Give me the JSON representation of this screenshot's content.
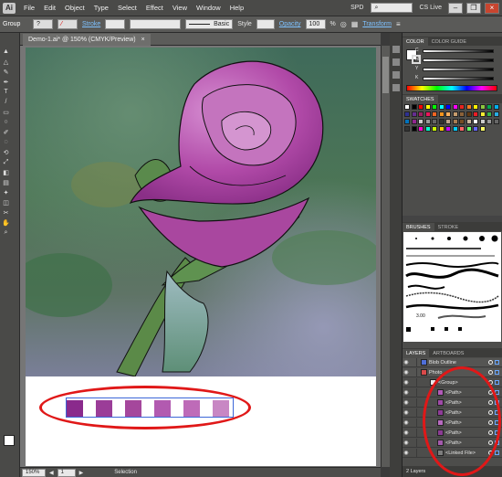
{
  "app_logo": "Ai",
  "menu": [
    "File",
    "Edit",
    "Object",
    "Type",
    "Select",
    "Effect",
    "View",
    "Window",
    "Help"
  ],
  "workspace": "SPD",
  "cs_live": "CS Live",
  "control": {
    "selection": "Group",
    "stroke_label": "Stroke",
    "brush_label": "Basic",
    "style_label": "Style",
    "opacity_label": "Opacity",
    "opacity_value": "100",
    "opacity_unit": "%",
    "transform_label": "Transform"
  },
  "document_tab": {
    "title": "Demo-1.ai* @ 150% (CMYK/Preview)",
    "close": "×"
  },
  "status": {
    "zoom": "150%",
    "artboard": "1",
    "tool": "Selection"
  },
  "color_panel": {
    "tabs": [
      "COLOR",
      "COLOR GUIDE"
    ],
    "sliders": [
      "C",
      "M",
      "Y",
      "K"
    ]
  },
  "swatches_panel": {
    "tabs": [
      "SWATCHES"
    ]
  },
  "brushes_panel": {
    "tabs": [
      "BRUSHES",
      "STROKE"
    ],
    "brush_size": "3.00"
  },
  "layers_panel": {
    "tabs": [
      "LAYERS",
      "ARTBOARDS"
    ],
    "rows": [
      {
        "name": "Blob Outline",
        "color": "#4f6fd8"
      },
      {
        "name": "Photo",
        "color": "#d94a4a"
      },
      {
        "name": "<Group>",
        "color": "#e8e8e8"
      },
      {
        "name": "<Path>",
        "color": "#b25ab8"
      },
      {
        "name": "<Path>",
        "color": "#a04aa8"
      },
      {
        "name": "<Path>",
        "color": "#8f3c98"
      },
      {
        "name": "<Path>",
        "color": "#b86ac0"
      },
      {
        "name": "<Path>",
        "color": "#8c3c94"
      },
      {
        "name": "<Path>",
        "color": "#a45aac"
      },
      {
        "name": "<Linked File>",
        "color": "#7d7d7d"
      }
    ],
    "footer": "2 Layers"
  },
  "canvas_swatches": [
    "#8a2a8c",
    "#9b3d98",
    "#a5479c",
    "#b25ab0",
    "#be6bb8",
    "#a44fa0",
    "#c887c4"
  ],
  "colors": {
    "accent": "#7ec2ff",
    "highlight": "#e01818",
    "flower": "#b14aa8"
  }
}
